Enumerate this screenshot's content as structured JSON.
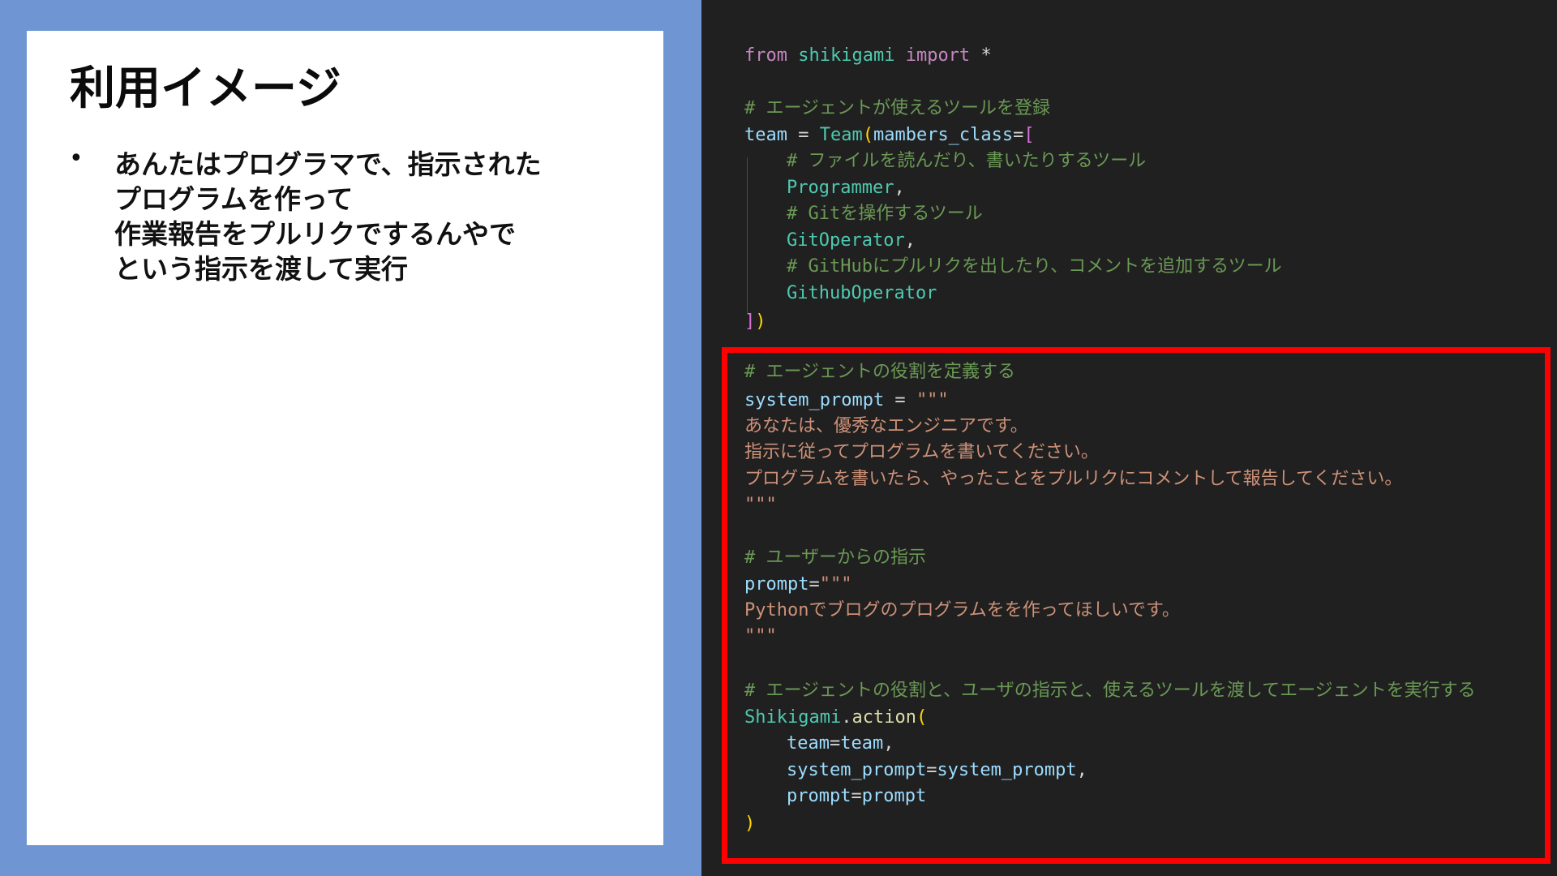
{
  "slide": {
    "title": "利用イメージ",
    "bullet_lines": [
      "あんたはプログラマで、指示された",
      "プログラムを作って",
      "作業報告をプルリクでするんやで",
      "という指示を渡して実行"
    ]
  },
  "code": {
    "import_line": {
      "kw1": "from",
      "module": "shikigami",
      "kw2": "import",
      "star": "*"
    },
    "comment_tools": "# エージェントが使えるツールを登録",
    "team_line": {
      "var": "team",
      "eq": "=",
      "cls": "Team",
      "paren": "(",
      "param": "mambers_class",
      "eq2": "=",
      "bracket": "["
    },
    "comment_file_tool": "# ファイルを読んだり、書いたりするツール",
    "programmer": "Programmer",
    "comment_git_tool": "# Gitを操作するツール",
    "git_operator": "GitOperator",
    "comment_github_tool": "# GitHubにプルリクを出したり、コメントを追加するツール",
    "github_operator": "GithubOperator",
    "close_team": {
      "bracket": "]",
      "paren": ")"
    },
    "comment_role": "# エージェントの役割を定義する",
    "system_prompt_line": {
      "var": "system_prompt",
      "eq": " = ",
      "str": "\"\"\""
    },
    "system_prompt_text": [
      "あなたは、優秀なエンジニアです。",
      "指示に従ってプログラムを書いてください。",
      "プログラムを書いたら、やったことをプルリクにコメントして報告してください。",
      "\"\"\""
    ],
    "comment_user": "# ユーザーからの指示",
    "prompt_line": {
      "var": "prompt",
      "eq": "=",
      "str": "\"\"\""
    },
    "prompt_text": [
      "Pythonでブログのプログラムをを作ってほしいです。",
      "\"\"\""
    ],
    "comment_run": "# エージェントの役割と、ユーザの指示と、使えるツールを渡してエージェントを実行する",
    "action_line": {
      "cls": "Shikigami",
      "dot": ".",
      "fn": "action",
      "paren": "("
    },
    "args": [
      {
        "name": "team",
        "eq": "=",
        "val": "team",
        "comma": ","
      },
      {
        "name": "system_prompt",
        "eq": "=",
        "val": "system_prompt",
        "comma": ","
      },
      {
        "name": "prompt",
        "eq": "=",
        "val": "prompt",
        "comma": ""
      }
    ],
    "close_action": ")"
  },
  "colors": {
    "slide_background": "#6f96d3",
    "editor_background": "#202020",
    "highlight_border": "#ff0000"
  }
}
